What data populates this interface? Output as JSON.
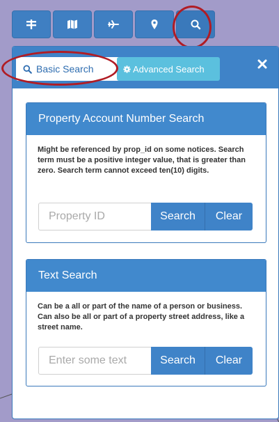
{
  "toolbar": {
    "buttons": [
      {
        "icon": "layers-icon"
      },
      {
        "icon": "map-icon"
      },
      {
        "icon": "plane-icon"
      },
      {
        "icon": "map-marker-icon"
      },
      {
        "icon": "search-icon"
      }
    ]
  },
  "panel": {
    "tabs": {
      "basic_label": "Basic Search",
      "advanced_label": "Advanced Search"
    },
    "close_icon": "close-icon"
  },
  "account_search": {
    "title": "Property Account Number Search",
    "description": "Might be referenced by prop_id on some notices. Search term must be a positive integer value, that is greater than zero. Search term cannot exceed ten(10) digits.",
    "input_placeholder": "Property ID",
    "search_label": "Search",
    "clear_label": "Clear"
  },
  "text_search": {
    "title": "Text Search",
    "description": "Can be a all or part of the name of a person or business. Can also be all or part of a property street address, like a street name.",
    "input_placeholder": "Enter some text",
    "search_label": "Search",
    "clear_label": "Clear"
  },
  "colors": {
    "primary": "#3f83c8",
    "info": "#5bc0de",
    "annotation": "#b01c24",
    "map_bg": "#a29bc9"
  }
}
